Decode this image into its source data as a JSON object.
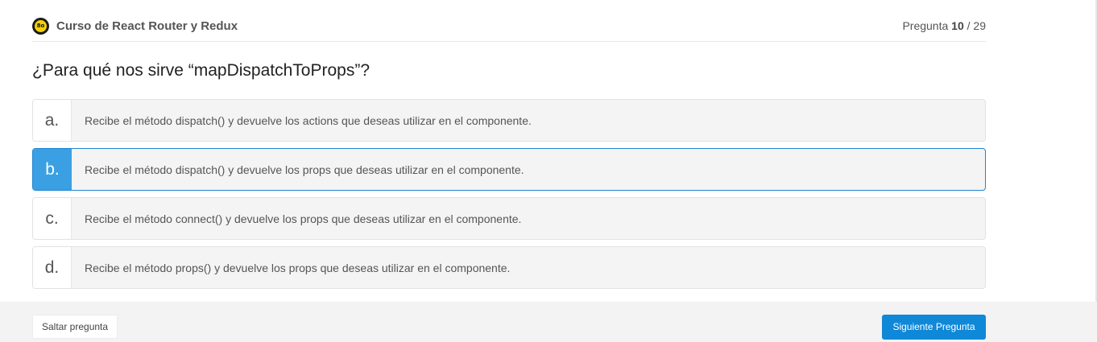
{
  "header": {
    "course_title": "Curso de React Router y Redux",
    "logo_text": "8o",
    "counter_prefix": "Pregunta ",
    "counter_current": "10",
    "counter_separator": " / ",
    "counter_total": "29"
  },
  "question": "¿Para qué nos sirve “mapDispatchToProps”?",
  "options": [
    {
      "letter": "a.",
      "text": "Recibe el método dispatch() y devuelve los actions que deseas utilizar en el componente.",
      "selected": false
    },
    {
      "letter": "b.",
      "text": "Recibe el método dispatch() y devuelve los props que deseas utilizar en el componente.",
      "selected": true
    },
    {
      "letter": "c.",
      "text": "Recibe el método connect() y devuelve los props que deseas utilizar en el componente.",
      "selected": false
    },
    {
      "letter": "d.",
      "text": "Recibe el método props() y devuelve los props que deseas utilizar en el componente.",
      "selected": false
    }
  ],
  "footer": {
    "skip_label": "Saltar pregunta",
    "next_label": "Siguiente Pregunta"
  },
  "colors": {
    "accent": "#0f88d8",
    "selected_letter_bg": "#3aa0e3",
    "logo_yellow": "#f5d10a"
  }
}
